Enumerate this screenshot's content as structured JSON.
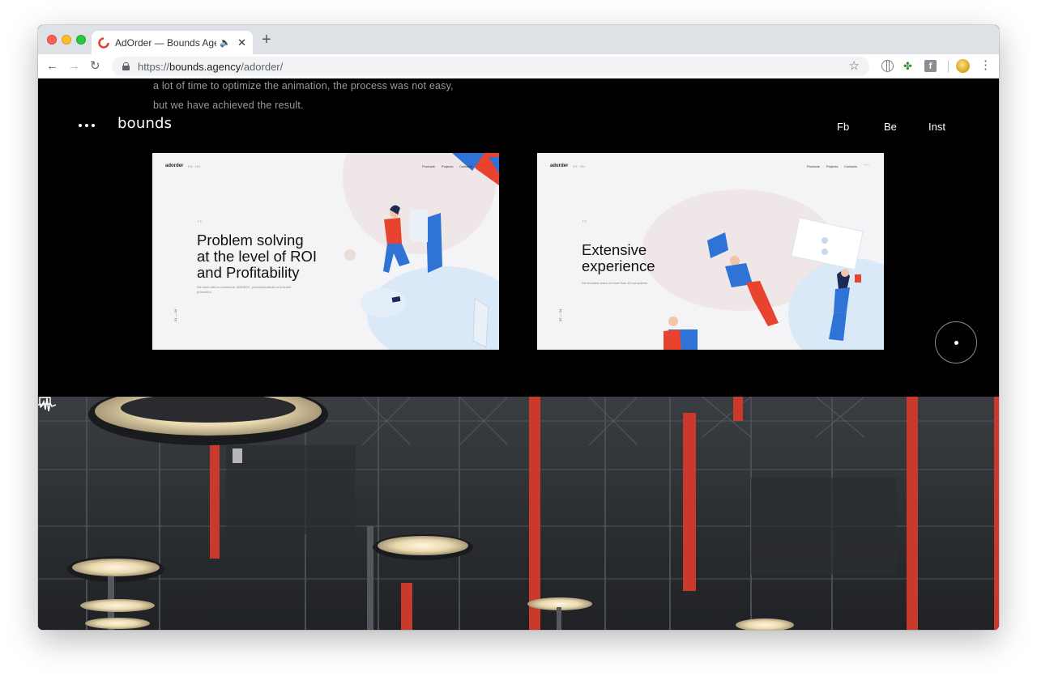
{
  "browser": {
    "tab": {
      "title": "AdOrder — Bounds Agency",
      "audio_icon": "speaker-icon",
      "close_label": "✕"
    },
    "new_tab_label": "+",
    "url": {
      "scheme": "https://",
      "host": "bounds.agency",
      "path": "/adorder/"
    },
    "extensions": [
      "globe-icon",
      "leaf-icon",
      "facebook-icon"
    ],
    "fb_ext_letter": "f"
  },
  "site": {
    "intro_lines": [
      "a lot of time to optimize the animation, the process was not easy,",
      "but we have achieved the result."
    ],
    "logo": "bounds",
    "social": {
      "fb": "Fb",
      "be": "Be",
      "inst": "Inst"
    }
  },
  "cards": [
    {
      "mini_logo": "adorder",
      "mini_lang": "EN · RU",
      "nav": [
        "Products",
        "Projects",
        "Contacts"
      ],
      "arrows": "‹  ›",
      "headline_lines": [
        "Problem solving",
        "at the level of ROI",
        "and Profitability"
      ],
      "description": "We work with e-commerce, B2B/B2C, pharmaceuticals and brand promotion",
      "side_label": "01 — 04"
    },
    {
      "mini_logo": "adorder",
      "mini_lang": "EN · RU",
      "nav": [
        "Products",
        "Projects",
        "Contacts"
      ],
      "arrows": "‹  ›",
      "headline_lines": [
        "Extensive",
        "experience"
      ],
      "description": "We boosted sales of more than 40 companies",
      "side_label": "02 — 04"
    }
  ],
  "colors": {
    "accent_red": "#e8432f",
    "accent_blue": "#2f73d6",
    "page_bg": "#000000"
  }
}
